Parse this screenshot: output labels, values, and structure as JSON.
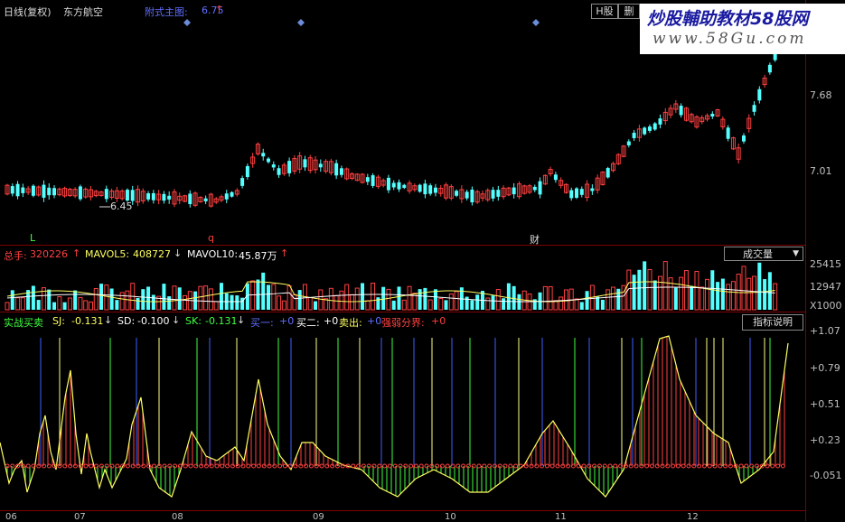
{
  "header": {
    "period": "日线(复权)",
    "stock": "东方航空",
    "indicator_label": "附式主图:",
    "indicator_value": "6.75",
    "h_share_btn": "H股",
    "delete_btn": "删"
  },
  "watermark": {
    "line1": "炒股輔助教材58股网",
    "line2": "www.58Gu.com"
  },
  "main_chart": {
    "y_ticks": [
      "7.68",
      "7.01"
    ],
    "low_label": "6.45",
    "markers": [
      "L",
      "q",
      "财"
    ]
  },
  "volume_panel": {
    "total_label": "总手:",
    "total_value": "320226",
    "mavol5_label": "MAVOL5:",
    "mavol5_value": "408727",
    "mavol10_label": "MAVOL10:",
    "mavol10_value": "45.87万",
    "select_value": "成交量",
    "y_ticks": [
      "25415",
      "12947",
      "X1000"
    ]
  },
  "indicator_panel": {
    "name": "实战买卖",
    "sj_label": "SJ:",
    "sj_value": "-0.131",
    "sd_label": "SD:",
    "sd_value": "-0.100",
    "sk_label": "SK:",
    "sk_value": "-0.131",
    "buy1_label": "买一:",
    "buy1_value": "+0",
    "buy2_label": "买二:",
    "buy2_value": "+0",
    "sell_label": "卖出:",
    "sell_value": "+0",
    "strength_label": "强弱分界:",
    "strength_value": "+0",
    "help_btn": "指标说明",
    "y_ticks": [
      "+1.07",
      "+0.79",
      "+0.51",
      "+0.23",
      "-0.051"
    ]
  },
  "x_axis": {
    "months": [
      "06",
      "07",
      "08",
      "09",
      "10",
      "11",
      "12"
    ]
  },
  "colors": {
    "up": "#ff4040",
    "down": "#54ffff",
    "ma_white": "#ffffff",
    "ma_yellow": "#ffff60",
    "green": "#40ff40",
    "blue_line": "#4060ff"
  }
}
